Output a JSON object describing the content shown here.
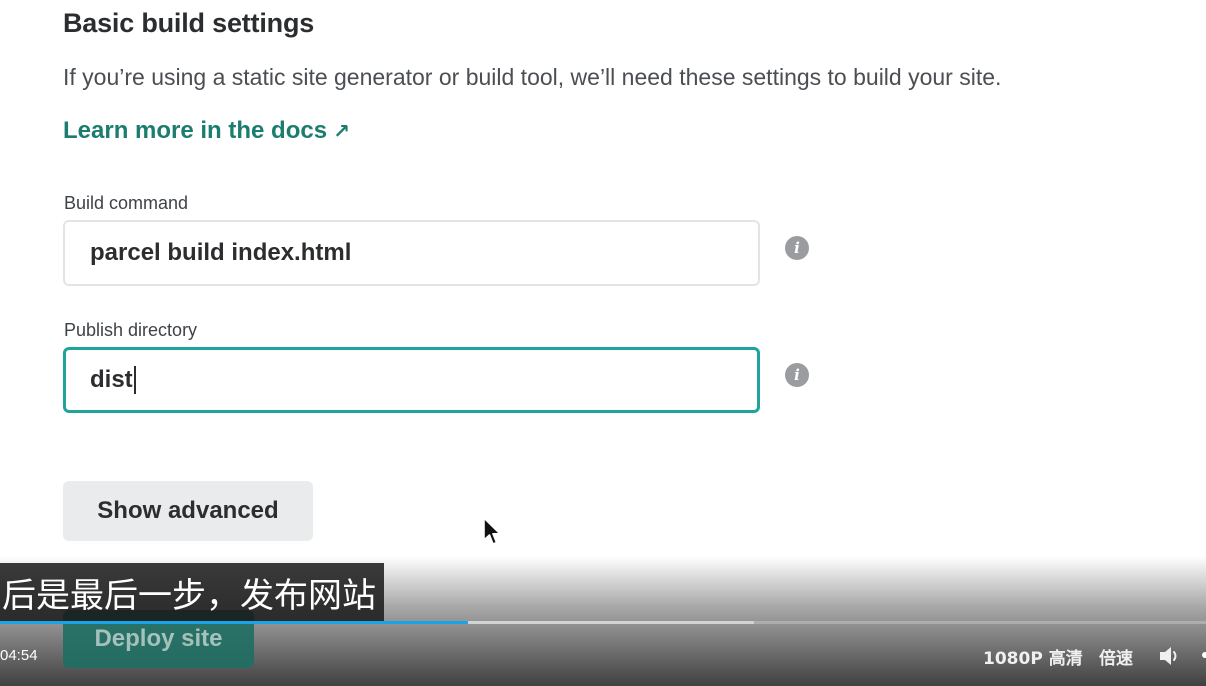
{
  "settings": {
    "title": "Basic build settings",
    "description": "If you’re using a static site generator or build tool, we’ll need these settings to build your site.",
    "docs_link": "Learn more in the docs",
    "docs_link_arrow": "↗",
    "build_command": {
      "label": "Build command",
      "value": "parcel build index.html"
    },
    "publish_directory": {
      "label": "Publish directory",
      "value": "dist"
    },
    "show_advanced_label": "Show advanced",
    "deploy_label": "Deploy site"
  },
  "player": {
    "subtitle": "后是最后一步，发布网站",
    "time": "04:54",
    "quality": "1080P 高清",
    "speed": "倍速",
    "progress_fraction": 0.388,
    "buffer_fraction": 0.625
  },
  "colors": {
    "link": "#1c7d6f",
    "focus_border": "#1fa39a",
    "progress": "#1aa3e8"
  },
  "icons": {
    "info": "info-icon",
    "cursor": "mouse-pointer-icon",
    "volume": "volume-icon"
  }
}
